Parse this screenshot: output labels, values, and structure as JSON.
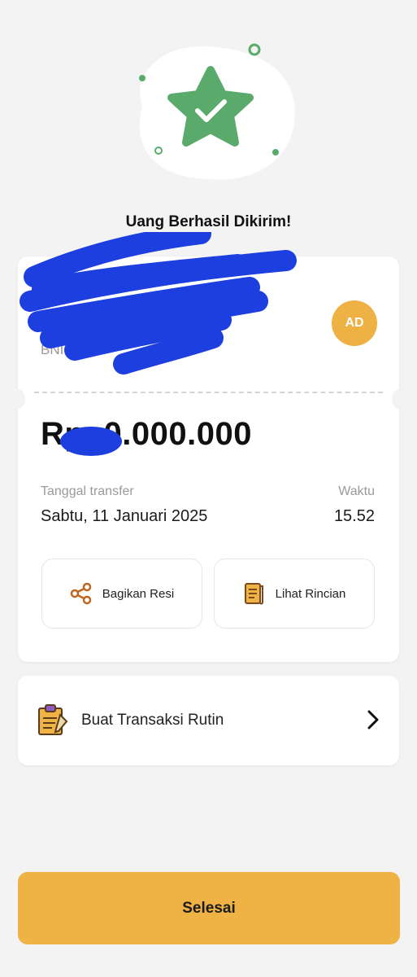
{
  "success": {
    "title": "Uang Berhasil Dikirim!"
  },
  "recipient": {
    "name": "",
    "bank": "BNI",
    "avatar_initials": "AD"
  },
  "transfer": {
    "amount": "Rp .0.000.000",
    "date_label": "Tanggal transfer",
    "date_value": "Sabtu, 11 Januari 2025",
    "time_label": "Waktu",
    "time_value": "15.52"
  },
  "actions": {
    "share_label": "Bagikan Resi",
    "share_icon": "share-icon",
    "detail_label": "Lihat Rincian",
    "detail_icon": "receipt-icon"
  },
  "routine": {
    "label": "Buat Transaksi Rutin",
    "icon": "clipboard-icon"
  },
  "footer": {
    "done_label": "Selesai"
  },
  "colors": {
    "accent": "#efb345",
    "success": "#5aab6b",
    "redaction": "#1d3fe0"
  }
}
